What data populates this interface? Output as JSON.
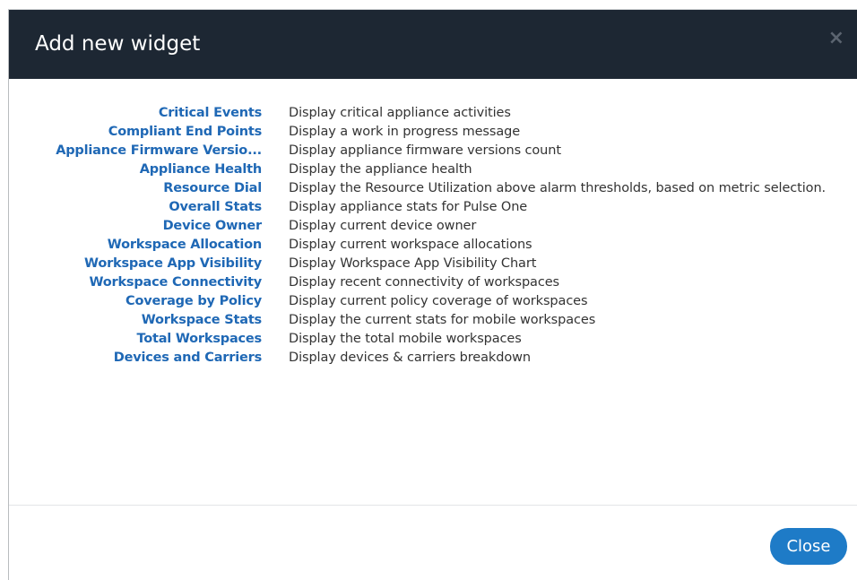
{
  "dialog": {
    "title": "Add new widget",
    "close_icon": "×",
    "close_button_label": "Close"
  },
  "widgets": [
    {
      "name": "Critical Events",
      "description": "Display critical appliance activities"
    },
    {
      "name": "Compliant End Points",
      "description": "Display a work in progress message"
    },
    {
      "name": "Appliance Firmware Versio...",
      "description": "Display appliance firmware versions count"
    },
    {
      "name": "Appliance Health",
      "description": "Display the appliance health"
    },
    {
      "name": "Resource Dial",
      "description": "Display the Resource Utilization above alarm thresholds, based on metric selection."
    },
    {
      "name": "Overall Stats",
      "description": "Display appliance stats for Pulse One"
    },
    {
      "name": "Device Owner",
      "description": "Display current device owner"
    },
    {
      "name": "Workspace Allocation",
      "description": "Display current workspace allocations"
    },
    {
      "name": "Workspace App Visibility",
      "description": "Display Workspace App Visibility Chart"
    },
    {
      "name": "Workspace Connectivity",
      "description": "Display recent connectivity of workspaces"
    },
    {
      "name": "Coverage by Policy",
      "description": "Display current policy coverage of workspaces"
    },
    {
      "name": "Workspace Stats",
      "description": "Display the current stats for mobile workspaces"
    },
    {
      "name": "Total Workspaces",
      "description": "Display the total mobile workspaces"
    },
    {
      "name": "Devices and Carriers",
      "description": "Display devices & carriers breakdown"
    }
  ],
  "colors": {
    "header_bg": "#1d2733",
    "link": "#1f68b5",
    "button": "#1e7bc7",
    "text": "#333333"
  }
}
